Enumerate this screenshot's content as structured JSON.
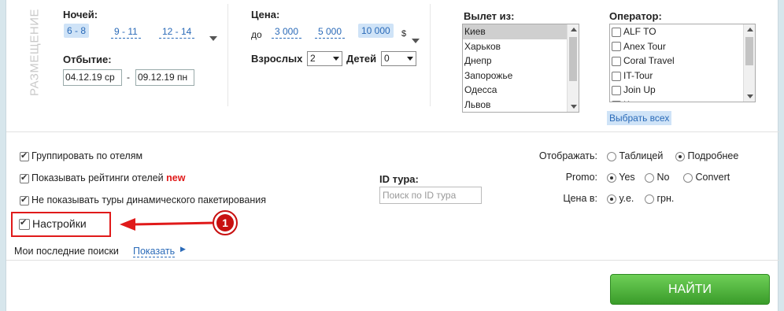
{
  "section_title": "РАЗМЕЩЕНИЕ",
  "nights": {
    "label": "Ночей:",
    "options": [
      "6 - 8",
      "9 - 11",
      "12 - 14"
    ],
    "selected": "6 - 8"
  },
  "departure": {
    "label": "Отбытие:",
    "from": "04.12.19 ср",
    "separator": "-",
    "to": "09.12.19 пн"
  },
  "price": {
    "label": "Цена:",
    "prefix": "до",
    "options": [
      "3 000",
      "5 000",
      "10 000"
    ],
    "selected": "10 000",
    "currency": "$"
  },
  "adults": {
    "label": "Взрослых",
    "value": "2"
  },
  "children": {
    "label": "Детей",
    "value": "0"
  },
  "departure_city": {
    "label": "Вылет из:",
    "items": [
      "Киев",
      "Харьков",
      "Днепр",
      "Запорожье",
      "Одесса",
      "Львов"
    ],
    "selected": "Киев"
  },
  "operator": {
    "label": "Оператор:",
    "items": [
      "ALF TO",
      "Anex Tour",
      "Coral Travel",
      "IT-Tour",
      "Join Up",
      "K"
    ],
    "select_all": "Выбрать всех"
  },
  "options": [
    {
      "label": "Группировать по отелям",
      "checked": true,
      "new_badge": ""
    },
    {
      "label": "Показывать рейтинги отелей",
      "checked": true,
      "new_badge": "new"
    },
    {
      "label": "Не показывать туры динамического пакетирования",
      "checked": true,
      "new_badge": ""
    }
  ],
  "settings": {
    "label": "Настройки",
    "checked": true
  },
  "tour_id": {
    "label": "ID тура:",
    "placeholder": "Поиск по ID тура"
  },
  "display": {
    "label": "Отображать:",
    "options": [
      "Таблицей",
      "Подробнее"
    ],
    "selected": "Подробнее"
  },
  "promo": {
    "label": "Promo:",
    "options": [
      "Yes",
      "No",
      "Convert"
    ],
    "selected": "Yes"
  },
  "price_in": {
    "label": "Цена в:",
    "options": [
      "у.е.",
      "грн."
    ],
    "selected": "у.е."
  },
  "recent_searches": {
    "label": "Мои последние поиски",
    "link": "Показать"
  },
  "search_button": "НАЙТИ",
  "annotation": {
    "number": "1"
  },
  "colors": {
    "link": "#2a6ab8",
    "chip_bg": "#cfe3f7",
    "annotation_red": "#e01a1a",
    "button_green": "#4cb43a",
    "new_red": "#e01a1a"
  }
}
